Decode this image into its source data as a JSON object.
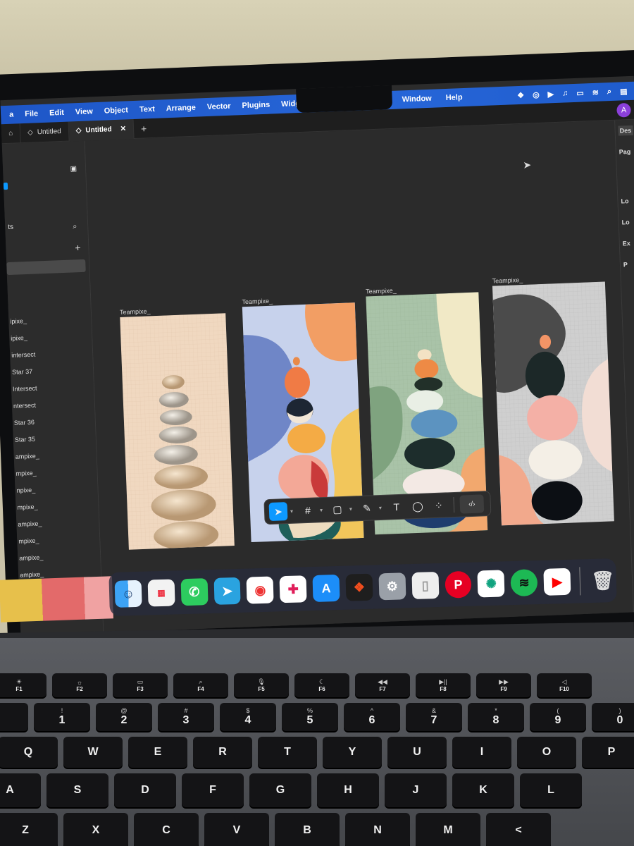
{
  "menubar": {
    "menus": [
      "a",
      "File",
      "Edit",
      "View",
      "Object",
      "Text",
      "Arrange",
      "Vector",
      "Plugins",
      "Widgets"
    ],
    "right_menus": [
      "Window",
      "Help"
    ]
  },
  "tabs": {
    "items": [
      {
        "label": "Untitled",
        "active": false
      },
      {
        "label": "Untitled",
        "active": true
      }
    ],
    "close_glyph": "✕",
    "add_glyph": "+",
    "avatar": "A"
  },
  "left_panel": {
    "header_fragment": "ts",
    "layers": [
      "ipixe_",
      "ipixe_",
      "intersect",
      "Star 37",
      "Intersect",
      "ntersect",
      "Star 36",
      "Star 35",
      "ampixe_",
      "mpixe_",
      "npixe_",
      "mpixe_",
      "ampixe_",
      "mpixe_",
      "ampixe_",
      "ampixe_"
    ]
  },
  "canvas": {
    "frames": [
      {
        "title": "Teampixe_"
      },
      {
        "title": "Teampixe_"
      },
      {
        "title": "Teampixe_"
      },
      {
        "title": "Teampixe_"
      }
    ]
  },
  "right_panel": {
    "labels": [
      "Des",
      "Pag",
      "Lo",
      "Lo",
      "Ex",
      "P"
    ]
  },
  "toolbar": {
    "tools": [
      "move-tool",
      "frame-tool",
      "shape-tool",
      "pen-tool",
      "text-tool",
      "comment-tool",
      "actions-tool",
      "dev-mode-toggle"
    ]
  },
  "dock": {
    "apps": [
      "Finder",
      "Launchpad",
      "WhatsApp",
      "Telegram",
      "Chrome",
      "Slack",
      "App Store",
      "Figma",
      "System Settings",
      "iPhone Mirroring",
      "Pinterest",
      "ChatGPT",
      "Spotify",
      "YouTube",
      "Trash"
    ]
  },
  "keyboard": {
    "fn_row": [
      {
        "icon": "☀",
        "label": "F1"
      },
      {
        "icon": "☼",
        "label": "F2"
      },
      {
        "icon": "▭",
        "label": "F3"
      },
      {
        "icon": "⌕",
        "label": "F4"
      },
      {
        "icon": "🎙",
        "label": "F5"
      },
      {
        "icon": "☾",
        "label": "F6"
      },
      {
        "icon": "◀◀",
        "label": "F7"
      },
      {
        "icon": "▶||",
        "label": "F8"
      },
      {
        "icon": "▶▶",
        "label": "F9"
      },
      {
        "icon": "◁",
        "label": "F10"
      }
    ],
    "num_row": [
      {
        "top": "!",
        "main": "1"
      },
      {
        "top": "@",
        "main": "2"
      },
      {
        "top": "#",
        "main": "3"
      },
      {
        "top": "$",
        "main": "4"
      },
      {
        "top": "%",
        "main": "5"
      },
      {
        "top": "^",
        "main": "6"
      },
      {
        "top": "&",
        "main": "7"
      },
      {
        "top": "*",
        "main": "8"
      },
      {
        "top": "(",
        "main": "9"
      },
      {
        "top": ")",
        "main": "0"
      }
    ],
    "qwerty_row": [
      "Q",
      "W",
      "E",
      "R",
      "T",
      "Y",
      "U",
      "I",
      "O",
      "P"
    ],
    "home_row": [
      "A",
      "S",
      "D",
      "F",
      "G",
      "H",
      "J",
      "K",
      "L"
    ],
    "bottom_row": [
      "Z",
      "X",
      "C",
      "V",
      "B",
      "N",
      "M",
      "<"
    ]
  }
}
